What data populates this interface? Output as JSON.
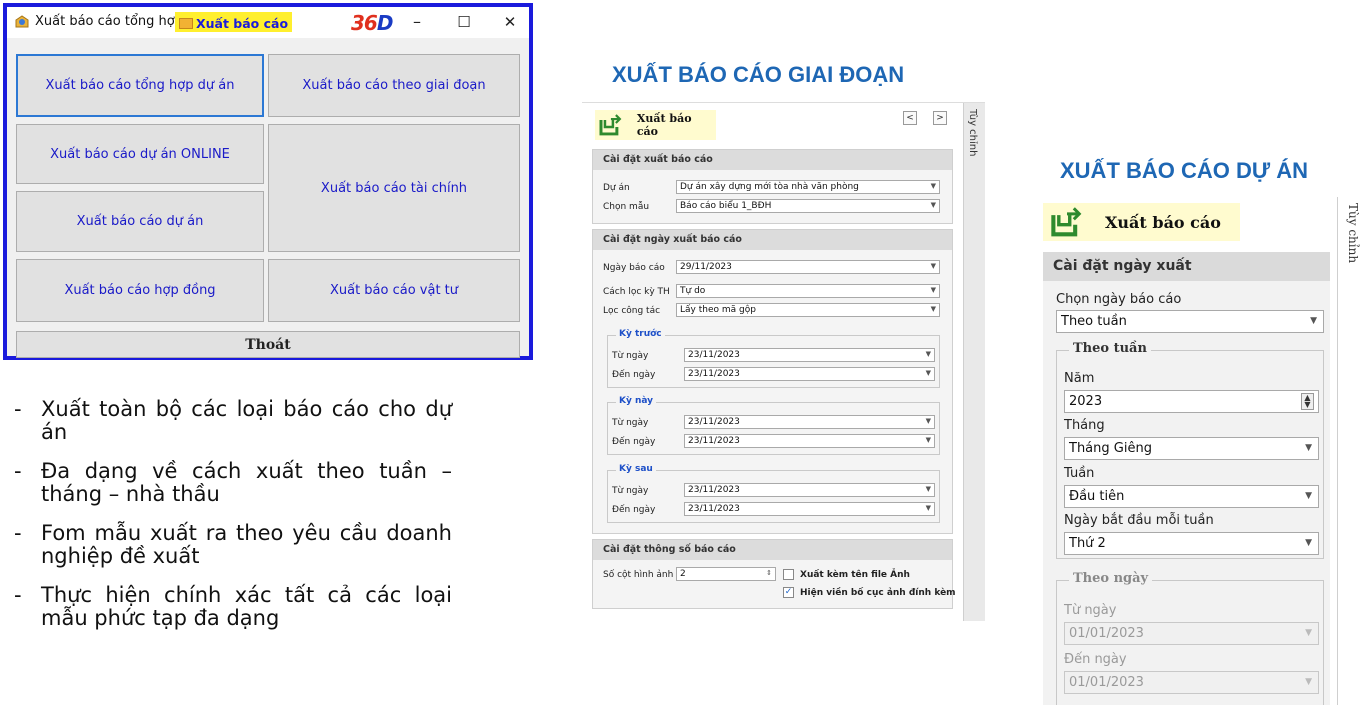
{
  "window1": {
    "title": "Xuất báo cáo tổng hợp",
    "tab": "Xuất báo cáo",
    "logo": {
      "part1": "36",
      "part2": "D"
    },
    "controls": {
      "minimize": "–",
      "maximize": "☐",
      "close": "✕"
    },
    "buttons": {
      "tong_hop": "Xuất báo cáo tổng hợp dự án",
      "giai_doan": "Xuất báo cáo theo giai đoạn",
      "online": "Xuất báo cáo dự án ONLINE",
      "tai_chinh": "Xuất báo cáo tài chính",
      "du_an": "Xuất báo cáo dự án",
      "hop_dong": "Xuất báo cáo hợp đồng",
      "vat_tu": "Xuất báo cáo vật tư",
      "thoat": "Thoát"
    }
  },
  "bullets": [
    "Xuất toàn bộ các loại báo cáo cho dự án",
    "Đa dạng về cách xuất theo tuần – tháng – nhà thầu",
    "Fom mẫu xuất ra theo yêu cầu doanh nghiệp đề xuất",
    "Thực hiện chính xác tất cả các loại mẫu phức tạp đa dạng"
  ],
  "headings": {
    "giai_doan": "XUẤT BÁO CÁO GIAI ĐOẠN",
    "du_an": "XUẤT BÁO CÁO DỰ ÁN"
  },
  "window2": {
    "header": "Xuất báo cáo",
    "side_tab": "Tùy chỉnh",
    "nav_prev": "<",
    "nav_next": ">",
    "group1": {
      "title": "Cài đặt xuất báo cáo",
      "du_an_label": "Dự án",
      "du_an_value": "Dự án xây dựng mới tòa nhà văn phòng",
      "chon_mau_label": "Chọn mẫu",
      "chon_mau_value": "Báo cáo biểu 1_BĐH"
    },
    "group2": {
      "title": "Cài đặt ngày xuất báo cáo",
      "ngay_label": "Ngày báo cáo",
      "ngay_value": "29/11/2023",
      "cach_loc_label": "Cách lọc kỳ TH",
      "cach_loc_value": "Tự do",
      "loc_cong_tac_label": "Lọc công tác",
      "loc_cong_tac_value": "Lấy theo mã gộp",
      "ky_truoc": {
        "title": "Kỳ trước",
        "tu_label": "Từ ngày",
        "tu_value": "23/11/2023",
        "den_label": "Đến ngày",
        "den_value": "23/11/2023"
      },
      "ky_nay": {
        "title": "Kỳ này",
        "tu_label": "Từ ngày",
        "tu_value": "23/11/2023",
        "den_label": "Đến ngày",
        "den_value": "23/11/2023"
      },
      "ky_sau": {
        "title": "Kỳ sau",
        "tu_label": "Từ ngày",
        "tu_value": "23/11/2023",
        "den_label": "Đến ngày",
        "den_value": "23/11/2023"
      }
    },
    "group3": {
      "title": "Cài đặt thông số báo cáo",
      "so_cot_label": "Số cột hình ảnh",
      "so_cot_value": "2",
      "chk1_label": "Xuất kèm tên file Ảnh",
      "chk1_checked": false,
      "chk2_label": "Hiện viền bố cục ảnh đính kèm",
      "chk2_checked": true
    }
  },
  "window3": {
    "header": "Xuất báo cáo",
    "side_tab": "Tùy chỉnh",
    "panel_title": "Cài đặt ngày xuất",
    "chon_ngay_label": "Chọn ngày báo cáo",
    "chon_ngay_value": "Theo tuần",
    "theo_tuan": {
      "title": "Theo tuần",
      "nam_label": "Năm",
      "nam_value": "2023",
      "thang_label": "Tháng",
      "thang_value": "Tháng Giêng",
      "tuan_label": "Tuần",
      "tuan_value": "Đầu tiên",
      "bat_dau_label": "Ngày bắt đầu mỗi tuần",
      "bat_dau_value": "Thứ 2"
    },
    "theo_ngay": {
      "title": "Theo ngày",
      "tu_label": "Từ ngày",
      "tu_value": "01/01/2023",
      "den_label": "Đến ngày",
      "den_value": "01/01/2023"
    }
  }
}
